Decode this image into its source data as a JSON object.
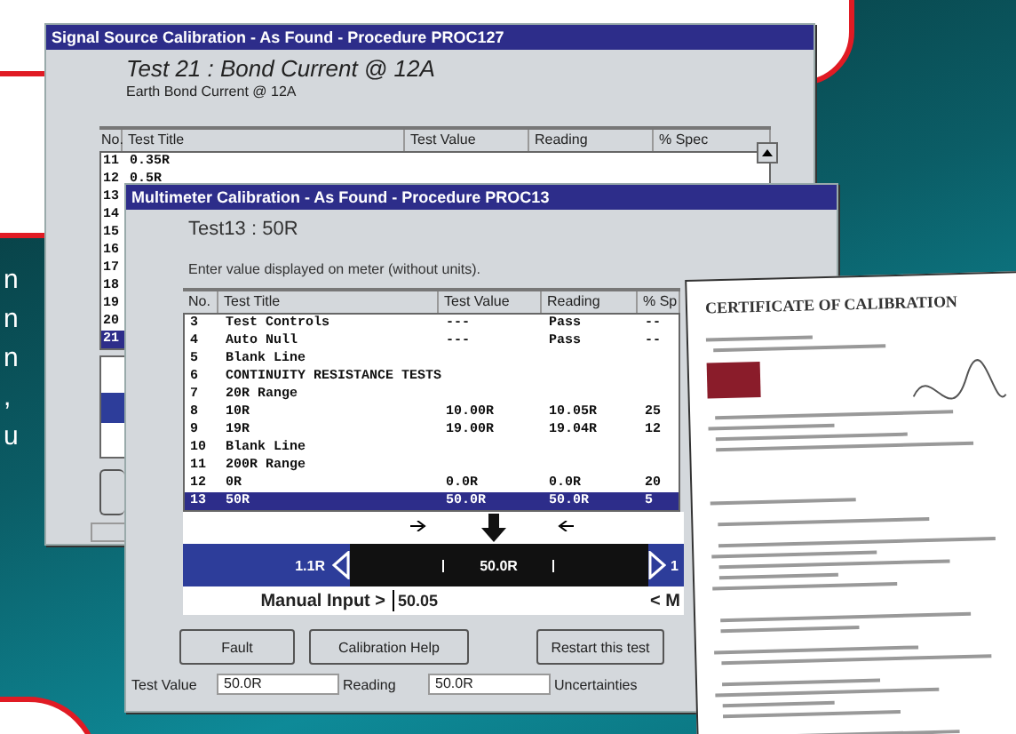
{
  "side_text": [
    "n",
    "n",
    "n",
    ",",
    "u"
  ],
  "back_window": {
    "title": "Signal Source Calibration - As Found - Procedure PROC127",
    "test_heading": "Test 21 : Bond Current @ 12A",
    "test_subheading": "Earth Bond Current @ 12A",
    "columns": [
      "No.",
      "Test Title",
      "Test Value",
      "Reading",
      "% Spec"
    ],
    "rows": [
      {
        "no": "11",
        "title": "0.35R",
        "selected": false
      },
      {
        "no": "12",
        "title": "0.5R",
        "selected": false
      },
      {
        "no": "13",
        "title": "",
        "selected": false
      },
      {
        "no": "14",
        "title": "",
        "selected": false
      },
      {
        "no": "15",
        "title": "",
        "selected": false
      },
      {
        "no": "16",
        "title": "",
        "selected": false
      },
      {
        "no": "17",
        "title": "",
        "selected": false
      },
      {
        "no": "18",
        "title": "",
        "selected": false
      },
      {
        "no": "19",
        "title": "",
        "selected": false
      },
      {
        "no": "20",
        "title": "",
        "selected": false
      },
      {
        "no": "21",
        "title": "",
        "selected": true
      }
    ]
  },
  "front_window": {
    "title": "Multimeter Calibration - As Found - Procedure PROC13",
    "test_heading": "Test13 : 50R",
    "instruction": "Enter value displayed on meter (without units).",
    "columns": [
      "No.",
      "Test Title",
      "Test Value",
      "Reading",
      "% Sp"
    ],
    "rows": [
      {
        "no": "3",
        "title": "Test Controls",
        "value": "---",
        "reading": "Pass",
        "spec": "--",
        "selected": false
      },
      {
        "no": "4",
        "title": "Auto Null",
        "value": "---",
        "reading": "Pass",
        "spec": "--",
        "selected": false
      },
      {
        "no": "5",
        "title": "Blank Line",
        "value": "",
        "reading": "",
        "spec": "",
        "selected": false
      },
      {
        "no": "6",
        "title": "CONTINUITY RESISTANCE TESTS",
        "value": "",
        "reading": "",
        "spec": "",
        "selected": false
      },
      {
        "no": "7",
        "title": "20R Range",
        "value": "",
        "reading": "",
        "spec": "",
        "selected": false
      },
      {
        "no": "8",
        "title": "10R",
        "value": "10.00R",
        "reading": "10.05R",
        "spec": "25",
        "selected": false
      },
      {
        "no": "9",
        "title": "19R",
        "value": "19.00R",
        "reading": "19.04R",
        "spec": "12",
        "selected": false
      },
      {
        "no": "10",
        "title": "Blank Line",
        "value": "",
        "reading": "",
        "spec": "",
        "selected": false
      },
      {
        "no": "11",
        "title": "200R Range",
        "value": "",
        "reading": "",
        "spec": "",
        "selected": false
      },
      {
        "no": "12",
        "title": "0R",
        "value": "0.0R",
        "reading": "0.0R",
        "spec": "20",
        "selected": false
      },
      {
        "no": "13",
        "title": "50R",
        "value": "50.0R",
        "reading": "50.0R",
        "spec": "5",
        "selected": true
      }
    ],
    "gauge": {
      "left_label": "1.1R",
      "center_label": "50.0R",
      "right_label": "1"
    },
    "manual_input": {
      "label": "Manual Input >",
      "value": "50.05",
      "right_label": "< M"
    },
    "buttons": [
      "Fault",
      "Calibration Help",
      "Restart this test"
    ],
    "status": [
      {
        "label": "Test Value",
        "value": "50.0R"
      },
      {
        "label": "Reading",
        "value": "50.0R"
      },
      {
        "label": "Uncertainties"
      }
    ]
  },
  "certificate": {
    "title": "CERTIFICATE OF CALIBRATION"
  }
}
